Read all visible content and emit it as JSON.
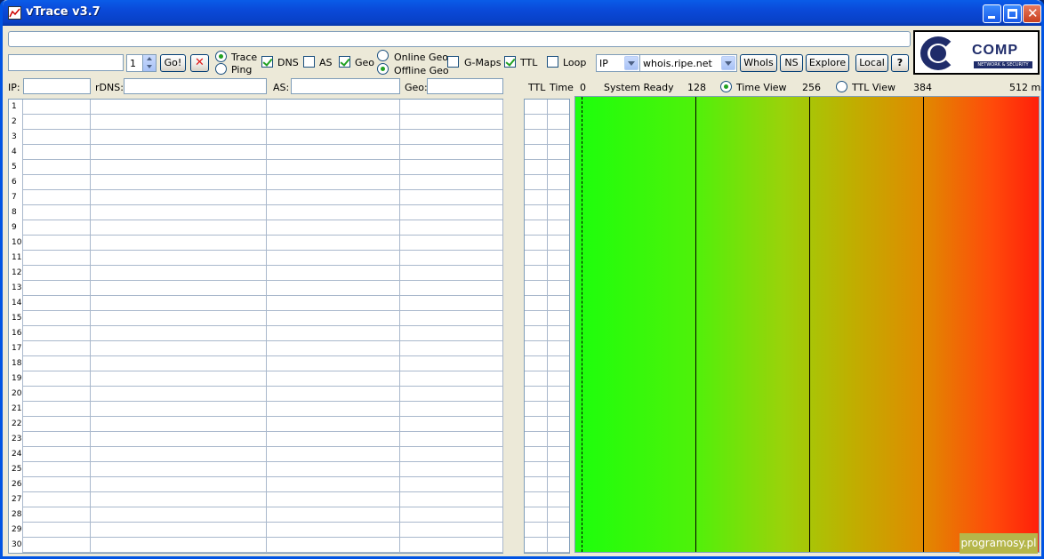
{
  "window": {
    "title": "vTrace v3.7"
  },
  "toolbar": {
    "host_value": "",
    "hops_value": "1",
    "go_label": "Go!",
    "mode_trace": "Trace",
    "mode_ping": "Ping",
    "dns_label": "DNS",
    "dns_checked": true,
    "as_label": "AS",
    "as_checked": false,
    "geo_label": "Geo",
    "geo_checked": true,
    "online_geo": "Online Geo",
    "offline_geo": "Offline Geo",
    "gmaps_label": "G-Maps",
    "gmaps_checked": false,
    "ttl_label": "TTL",
    "ttl_checked": true,
    "loop_label": "Loop",
    "loop_checked": false,
    "type_select": "IP",
    "whois_server": "whois.ripe.net",
    "whois_label": "WhoIs",
    "ns_label": "NS",
    "explore_label": "Explore",
    "local_label": "Local",
    "help_label": "?"
  },
  "logo": {
    "text": "COMP",
    "sub": "NETWORK & SECURITY"
  },
  "filters": {
    "ip_label": "IP:",
    "rdns_label": "rDNS:",
    "as_label": "AS:",
    "geo_label": "Geo:"
  },
  "graph_header": {
    "ttl": "TTL",
    "time": "Time",
    "t0": "0",
    "status": "System Ready",
    "t128": "128",
    "time_view": "Time View",
    "t256": "256",
    "ttl_view": "TTL View",
    "t384": "384",
    "t512": "512 ms"
  },
  "rows": [
    "1",
    "2",
    "3",
    "4",
    "5",
    "6",
    "7",
    "8",
    "9",
    "10",
    "11",
    "12",
    "13",
    "14",
    "15",
    "16",
    "17",
    "18",
    "19",
    "20",
    "21",
    "22",
    "23",
    "24",
    "25",
    "26",
    "27",
    "28",
    "29",
    "30"
  ],
  "watermark": "programosy.pl"
}
